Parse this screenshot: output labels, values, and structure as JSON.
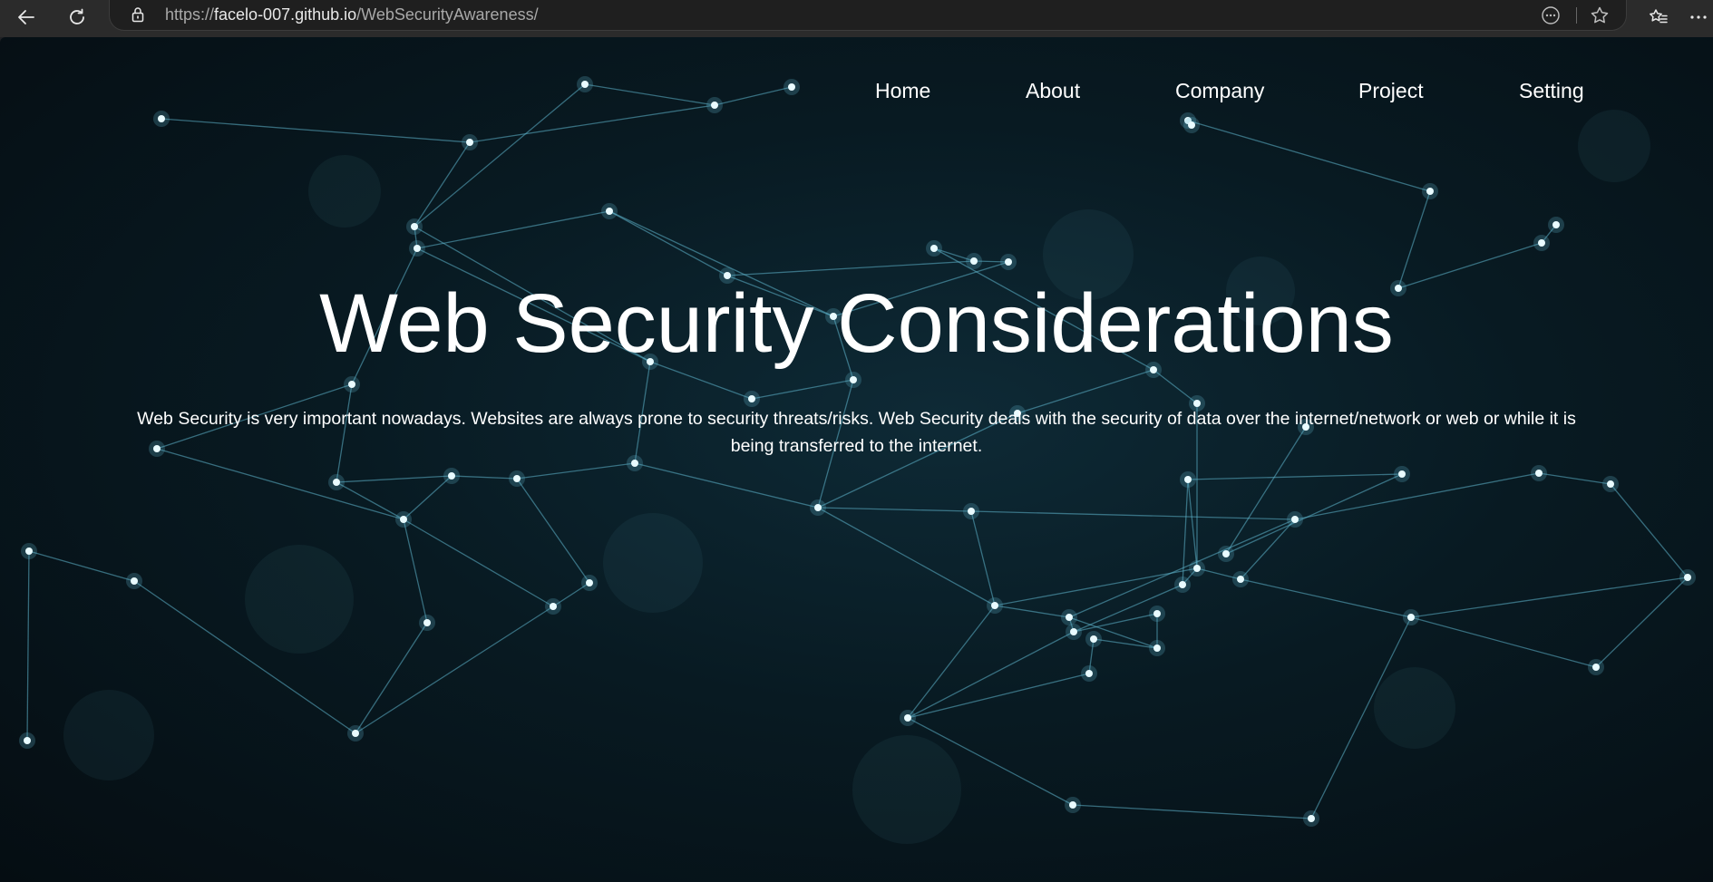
{
  "browser": {
    "url_scheme": "https://",
    "url_host": "facelo-007.github.io",
    "url_path": "/WebSecurityAwareness/",
    "icons": [
      "back-arrow-icon",
      "reload-icon",
      "lock-icon",
      "more-options-icon",
      "star-icon",
      "favorites-icon",
      "ellipsis-icon"
    ]
  },
  "nav": {
    "items": [
      {
        "label": "Home"
      },
      {
        "label": "About"
      },
      {
        "label": "Company"
      },
      {
        "label": "Project"
      },
      {
        "label": "Setting"
      }
    ]
  },
  "hero": {
    "title": "Web Security Considerations",
    "description": "Web Security is very important nowadays. Websites are always prone to security threats/risks. Web Security deals with the security of data over the internet/network or web or while it is being transferred to the internet."
  },
  "colors": {
    "browser_bar": "#2b2b2b",
    "address_bar": "#1f1f1f",
    "background": "#081a22",
    "network_line": "#5fb4cc",
    "network_node": "#e9fbff",
    "text": "#ffffff"
  }
}
